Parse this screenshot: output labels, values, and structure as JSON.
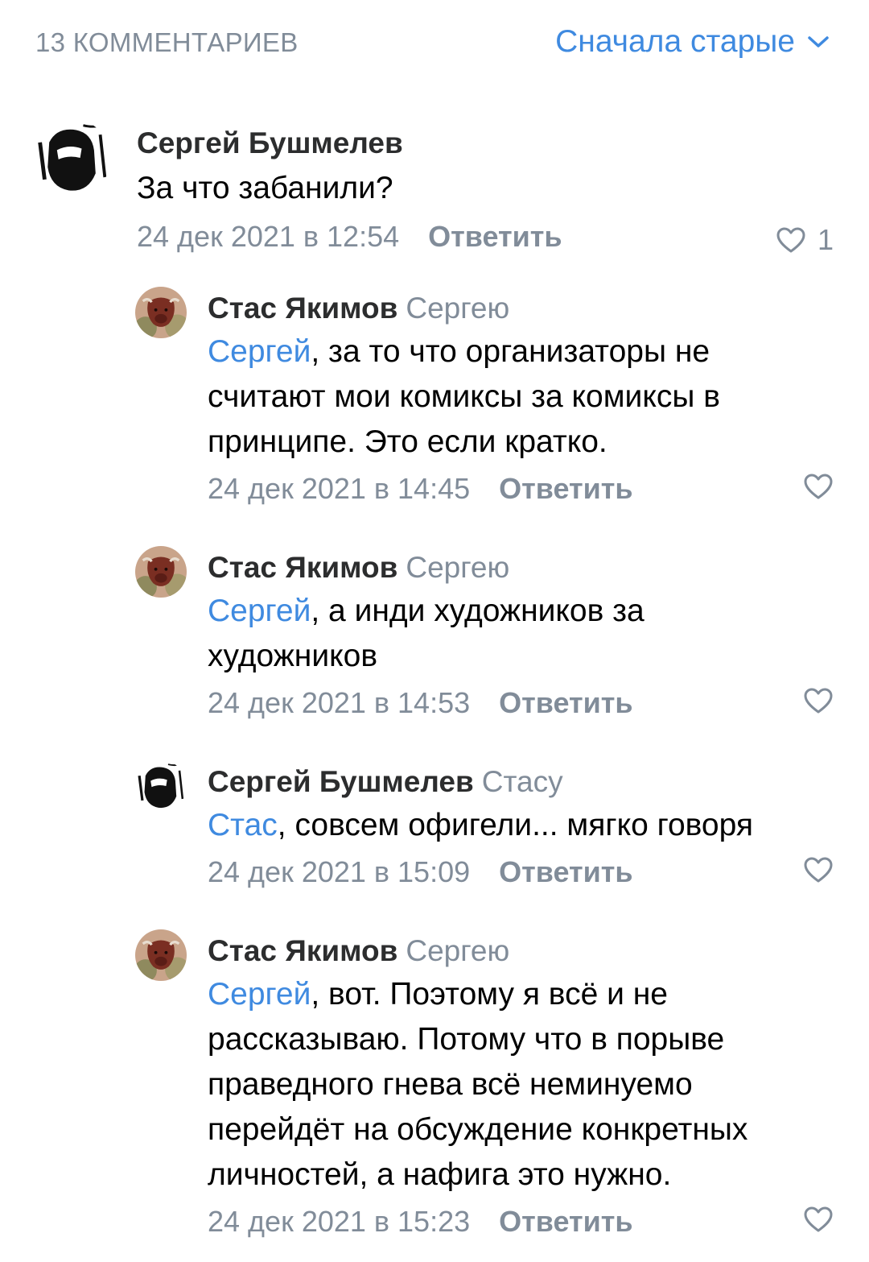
{
  "header": {
    "comment_count": "13 КОММЕНТАРИЕВ",
    "sort_label": "Сначала старые",
    "sort_icon": "chevron-down-icon"
  },
  "colors": {
    "accent": "#3f8ae0",
    "secondary": "#818c99",
    "text": "#000000"
  },
  "comments": [
    {
      "author": "Сергей Бушмелев",
      "reply_to": "",
      "mention": "",
      "text": "За что забанили?",
      "date": "24 дек 2021 в 12:54",
      "reply_label": "Ответить",
      "likes": "1",
      "avatar": "bw-photo-avatar"
    },
    {
      "author": "Стас Якимов",
      "reply_to": "Сергею",
      "mention": "Сергей",
      "text": ", за то что организаторы не считают мои комиксы за комиксы в принципе. Это если кратко.",
      "date": "24 дек 2021 в 14:45",
      "reply_label": "Ответить",
      "likes": "",
      "avatar": "cow-photo-avatar"
    },
    {
      "author": "Стас Якимов",
      "reply_to": "Сергею",
      "mention": "Сергей",
      "text": ", а инди художников за художников",
      "date": "24 дек 2021 в 14:53",
      "reply_label": "Ответить",
      "likes": "",
      "avatar": "cow-photo-avatar"
    },
    {
      "author": "Сергей Бушмелев",
      "reply_to": "Стасу",
      "mention": "Стас",
      "text": ", совсем офигели... мягко говоря",
      "date": "24 дек 2021 в 15:09",
      "reply_label": "Ответить",
      "likes": "",
      "avatar": "bw-photo-avatar"
    },
    {
      "author": "Стас Якимов",
      "reply_to": "Сергею",
      "mention": "Сергей",
      "text": ", вот. Поэтому я всё и не рассказываю. Потому что в порыве праведного гнева всё неминуемо перейдёт на обсуждение конкретных личностей, а нафига это нужно.",
      "date": "24 дек 2021 в 15:23",
      "reply_label": "Ответить",
      "likes": "",
      "avatar": "cow-photo-avatar"
    }
  ]
}
